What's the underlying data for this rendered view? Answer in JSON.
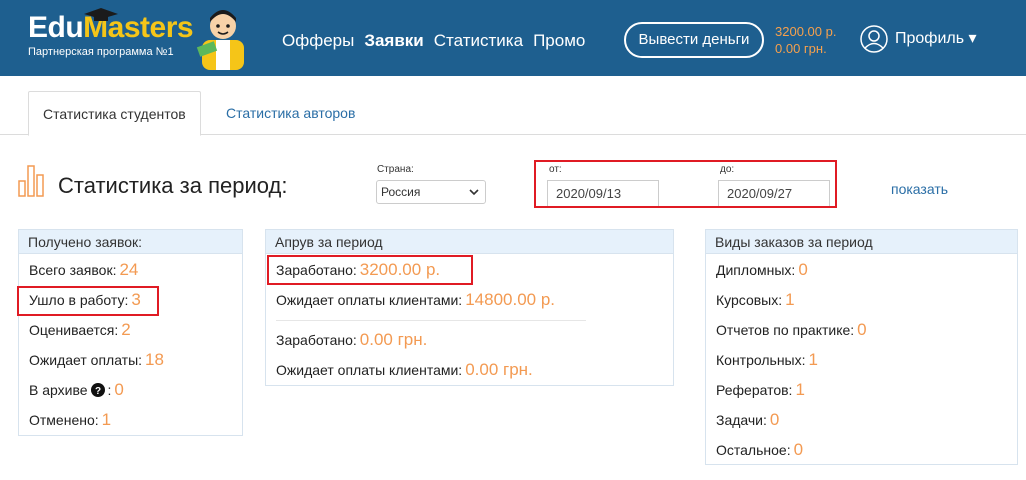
{
  "header": {
    "logo_main": "Edu",
    "logo_accent": "Masters",
    "logo_sub": "Партнерская программа №1",
    "nav": [
      {
        "label": "Офферы"
      },
      {
        "label": "Заявки"
      },
      {
        "label": "Статистика"
      },
      {
        "label": "Промо"
      }
    ],
    "withdraw_label": "Вывести деньги",
    "balance_rub": "3200.00 р.",
    "balance_uah": "0.00 грн.",
    "profile_label": "Профиль ▾"
  },
  "tabs": [
    {
      "label": "Статистика студентов",
      "active": true
    },
    {
      "label": "Статистика авторов",
      "active": false
    }
  ],
  "filters": {
    "title": "Статистика за период:",
    "country_label": "Страна:",
    "country_value": "Россия",
    "from_label": "от:",
    "from_value": "2020/09/13",
    "to_label": "до:",
    "to_value": "2020/09/27",
    "show_label": "показать"
  },
  "received": {
    "title": "Получено заявок:",
    "rows": [
      {
        "label": "Всего заявок:",
        "value": "24"
      },
      {
        "label": "Ушло в работу:",
        "value": "3"
      },
      {
        "label": "Оценивается:",
        "value": "2"
      },
      {
        "label": "Ожидает оплаты:",
        "value": "18"
      },
      {
        "label": "В архиве",
        "suffix": ":",
        "value": "0"
      },
      {
        "label": "Отменено:",
        "value": "1"
      }
    ]
  },
  "approve": {
    "title": "Апрув за период",
    "rows": [
      {
        "label": "Заработано:",
        "value": "3200.00 р."
      },
      {
        "label": "Ожидает оплаты клиентами:",
        "value": "14800.00 р."
      },
      {
        "label": "Заработано:",
        "value": "0.00 грн."
      },
      {
        "label": "Ожидает оплаты клиентами:",
        "value": "0.00 грн."
      }
    ]
  },
  "orders": {
    "title": "Виды заказов за период",
    "rows": [
      {
        "label": "Дипломных:",
        "value": "0"
      },
      {
        "label": "Курсовых:",
        "value": "1"
      },
      {
        "label": "Отчетов по практике:",
        "value": "0"
      },
      {
        "label": "Контрольных:",
        "value": "1"
      },
      {
        "label": "Рефератов:",
        "value": "1"
      },
      {
        "label": "Задачи:",
        "value": "0"
      },
      {
        "label": "Остальное:",
        "value": "0"
      }
    ]
  },
  "colors": {
    "header_bg": "#1e5f8f",
    "accent_orange": "#f39a52",
    "highlight_red": "#e01b24",
    "link_blue": "#2a6ea6"
  }
}
